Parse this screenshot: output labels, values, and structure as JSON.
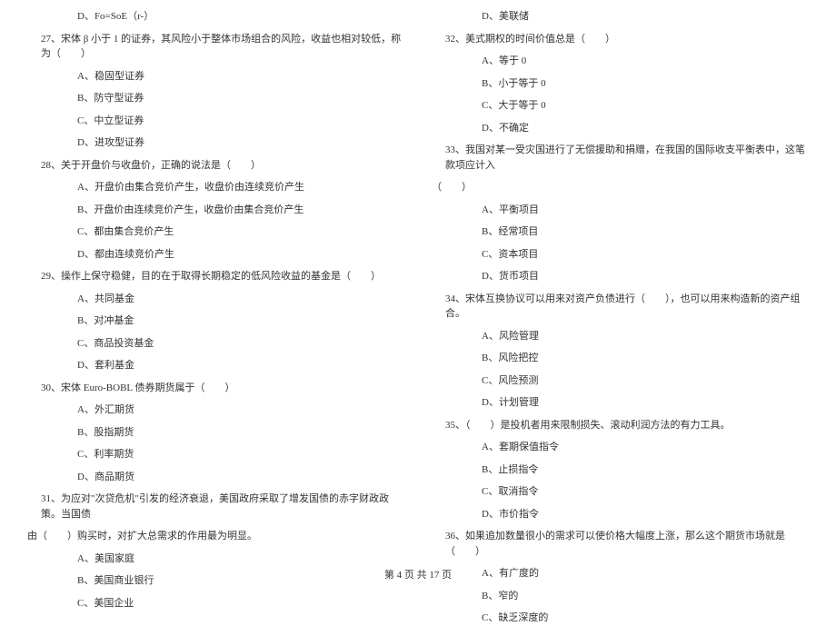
{
  "left": {
    "prev_option": "D、Fo=SoE（r-）",
    "questions": [
      {
        "num": "27、",
        "stem": "宋体 β 小于 1 的证券，其风险小于整体市场组合的风险，收益也相对较低，称为（　　）",
        "options": [
          "A、稳固型证券",
          "B、防守型证券",
          "C、中立型证券",
          "D、进攻型证券"
        ]
      },
      {
        "num": "28、",
        "stem": "关于开盘价与收盘价，正确的说法是（　　）",
        "options": [
          "A、开盘价由集合竞价产生，收盘价由连续竞价产生",
          "B、开盘价由连续竞价产生，收盘价由集合竞价产生",
          "C、都由集合竞价产生",
          "D、都由连续竞价产生"
        ]
      },
      {
        "num": "29、",
        "stem": "操作上保守稳健，目的在于取得长期稳定的低风险收益的基金是（　　）",
        "options": [
          "A、共同基金",
          "B、对冲基金",
          "C、商品投资基金",
          "D、套利基金"
        ]
      },
      {
        "num": "30、",
        "stem": "宋体 Euro-BOBL 债券期货属于（　　）",
        "options": [
          "A、外汇期货",
          "B、股指期货",
          "C、利率期货",
          "D、商品期货"
        ]
      },
      {
        "num": "31、",
        "stem": "为应对\"次贷危机\"引发的经济衰退，美国政府采取了增发国债的赤字财政政策。当国债",
        "cont": "由（　　）购买时，对扩大总需求的作用最为明显。",
        "options": [
          "A、美国家庭",
          "B、美国商业银行",
          "C、美国企业"
        ]
      }
    ]
  },
  "right": {
    "prev_option": "D、美联储",
    "questions": [
      {
        "num": "32、",
        "stem": "美式期权的时间价值总是（　　）",
        "options": [
          "A、等于 0",
          "B、小于等于 0",
          "C、大于等于 0",
          "D、不确定"
        ]
      },
      {
        "num": "33、",
        "stem": "我国对某一受灾国进行了无偿援助和捐赠，在我国的国际收支平衡表中，这笔款项应计入",
        "cont": "（　　）",
        "options": [
          "A、平衡项目",
          "B、经常项目",
          "C、资本项目",
          "D、货币项目"
        ]
      },
      {
        "num": "34、",
        "stem": "宋体互换协议可以用来对资产负债进行（　　），也可以用来构造新的资产组合。",
        "options": [
          "A、风险管理",
          "B、风险把控",
          "C、风险预测",
          "D、计划管理"
        ]
      },
      {
        "num": "35、",
        "stem": "（　　）是投机者用来限制损失、滚动利润方法的有力工具。",
        "options": [
          "A、套期保值指令",
          "B、止损指令",
          "C、取消指令",
          "D、市价指令"
        ]
      },
      {
        "num": "36、",
        "stem": "如果追加数量很小的需求可以使价格大幅度上涨，那么这个期货市场就是（　　）",
        "options": [
          "A、有广度的",
          "B、窄的",
          "C、缺乏深度的"
        ]
      }
    ]
  },
  "footer": "第 4 页 共 17 页"
}
